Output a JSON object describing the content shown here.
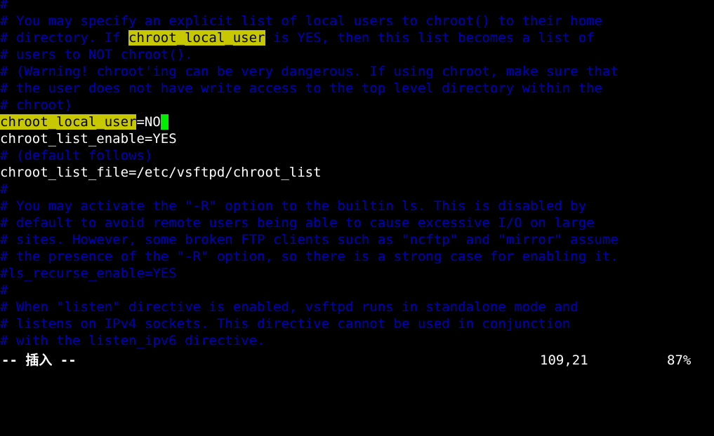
{
  "terminal": {
    "background_color": "#000000",
    "foreground_color": "#ffffff",
    "comment_color": "#0000bb",
    "search_highlight_bg": "#c8c800",
    "search_highlight_fg": "#000000",
    "cursor_color": "#00ee00"
  },
  "lines": [
    {
      "id": "line-1",
      "segments": [
        {
          "style": "comment",
          "text": "#"
        }
      ]
    },
    {
      "id": "line-2",
      "segments": [
        {
          "style": "comment",
          "text": "# You may specify an explicit list of local users to chroot() to their home"
        }
      ]
    },
    {
      "id": "line-3",
      "segments": [
        {
          "style": "comment",
          "text": "# directory. If "
        },
        {
          "style": "search",
          "text": "chroot_local_user"
        },
        {
          "style": "comment",
          "text": " is YES, then this list becomes a list of"
        }
      ]
    },
    {
      "id": "line-4",
      "segments": [
        {
          "style": "comment",
          "text": "# users to NOT chroot()."
        }
      ]
    },
    {
      "id": "line-5",
      "segments": [
        {
          "style": "comment",
          "text": "# (Warning! chroot'ing can be very dangerous. If using chroot, make sure that"
        }
      ]
    },
    {
      "id": "line-6",
      "segments": [
        {
          "style": "comment",
          "text": "# the user does not have write access to the top level directory within the"
        }
      ]
    },
    {
      "id": "line-7",
      "segments": [
        {
          "style": "comment",
          "text": "# chroot)"
        }
      ]
    },
    {
      "id": "line-8",
      "segments": [
        {
          "style": "search",
          "text": "chroot_local_user"
        },
        {
          "style": "text",
          "text": "=NO"
        },
        {
          "style": "cursor",
          "text": " "
        }
      ]
    },
    {
      "id": "line-9",
      "segments": [
        {
          "style": "text",
          "text": "chroot_list_enable=YES"
        }
      ]
    },
    {
      "id": "line-10",
      "segments": [
        {
          "style": "comment",
          "text": "# (default follows)"
        }
      ]
    },
    {
      "id": "line-11",
      "segments": [
        {
          "style": "text",
          "text": "chroot_list_file=/etc/vsftpd/chroot_list"
        }
      ]
    },
    {
      "id": "line-12",
      "segments": [
        {
          "style": "comment",
          "text": "#"
        }
      ]
    },
    {
      "id": "line-13",
      "segments": [
        {
          "style": "comment",
          "text": "# You may activate the \"-R\" option to the builtin ls. This is disabled by"
        }
      ]
    },
    {
      "id": "line-14",
      "segments": [
        {
          "style": "comment",
          "text": "# default to avoid remote users being able to cause excessive I/O on large"
        }
      ]
    },
    {
      "id": "line-15",
      "segments": [
        {
          "style": "comment",
          "text": "# sites. However, some broken FTP clients such as \"ncftp\" and \"mirror\" assume"
        }
      ]
    },
    {
      "id": "line-16",
      "segments": [
        {
          "style": "comment",
          "text": "# the presence of the \"-R\" option, so there is a strong case for enabling it."
        }
      ]
    },
    {
      "id": "line-17",
      "segments": [
        {
          "style": "comment",
          "text": "#ls_recurse_enable=YES"
        }
      ]
    },
    {
      "id": "line-18",
      "segments": [
        {
          "style": "comment",
          "text": "#"
        }
      ]
    },
    {
      "id": "line-19",
      "segments": [
        {
          "style": "comment",
          "text": "# When \"listen\" directive is enabled, vsftpd runs in standalone mode and"
        }
      ]
    },
    {
      "id": "line-20",
      "segments": [
        {
          "style": "comment",
          "text": "# listens on IPv4 sockets. This directive cannot be used in conjunction"
        }
      ]
    },
    {
      "id": "line-21",
      "segments": [
        {
          "style": "comment",
          "text": "# with the listen_ipv6 directive."
        }
      ]
    }
  ],
  "statusline": {
    "mode": "-- 插入 --",
    "ruler": "109,21",
    "percent": "87%"
  }
}
